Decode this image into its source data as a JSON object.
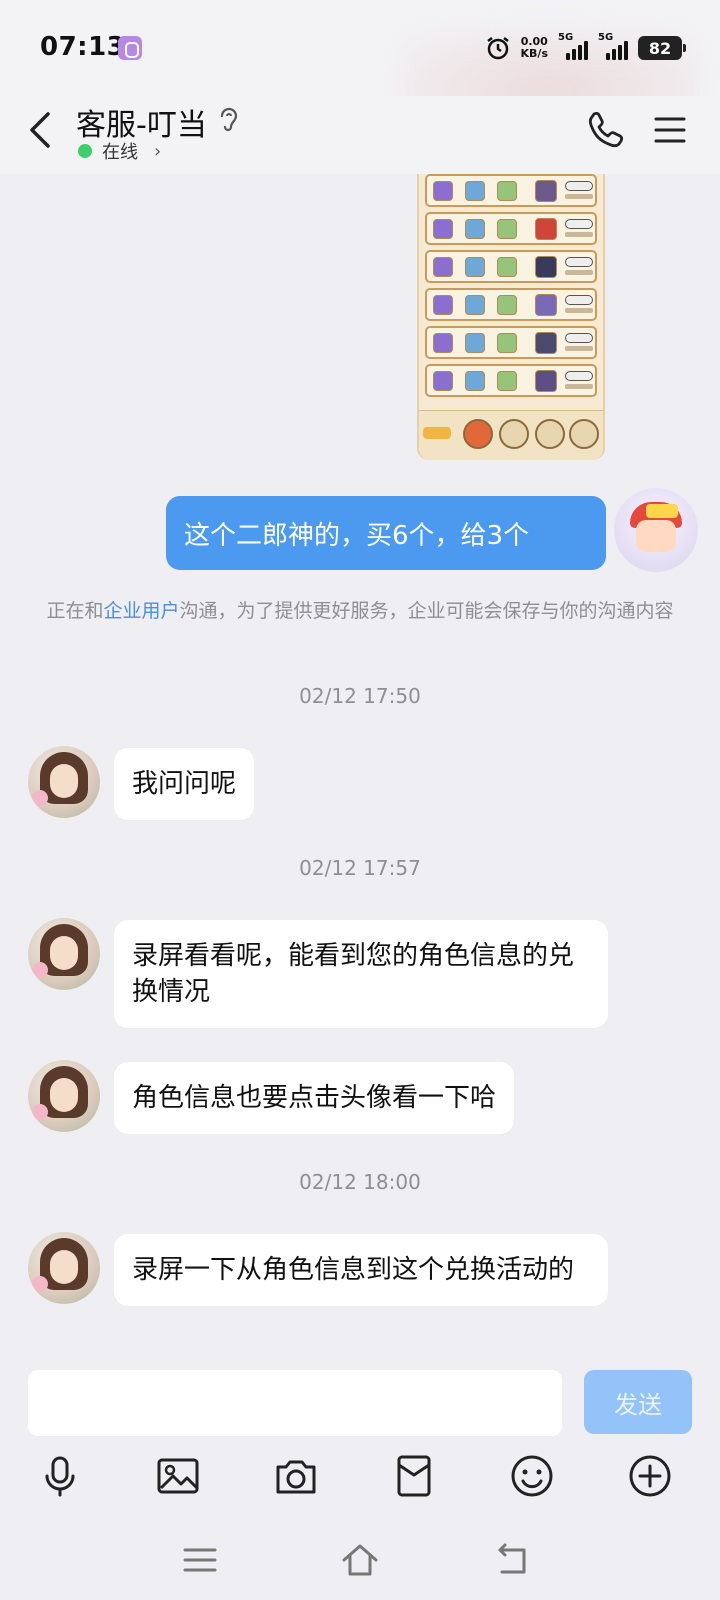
{
  "status_bar": {
    "time": "07:13",
    "net_speed_value": "0.00",
    "net_speed_unit": "KB/s",
    "signal1_label": "5G",
    "signal2_label": "5G",
    "battery_level": "82"
  },
  "header": {
    "title": "客服-叮当",
    "presence_label": "在线"
  },
  "messages": {
    "outgoing_1": "这个二郎神的，买6个，给3个",
    "notice_before": "正在和",
    "notice_link": "企业用户",
    "notice_after": "沟通，为了提供更好服务，企业可能会保存与你的沟通内容",
    "time_1": "02/12 17:50",
    "incoming_1": "我问问呢",
    "time_2": "02/12 17:57",
    "incoming_2": "录屏看看呢，能看到您的角色信息的兑换情况",
    "incoming_3": "角色信息也要点击头像看一下哈",
    "time_3": "02/12 18:00",
    "incoming_4": "录屏一下从角色信息到这个兑换活动的"
  },
  "composer": {
    "value": "",
    "send_label": "发送"
  },
  "toolbar": {
    "icons": [
      "microphone-icon",
      "image-icon",
      "camera-icon",
      "red-packet-icon",
      "emoji-icon",
      "plus-icon"
    ]
  },
  "colors": {
    "outgoing_bubble": "#4b9af0",
    "send_button": "#93c3f8",
    "online_dot": "#3ccf6c",
    "link": "#4a8fe0"
  }
}
